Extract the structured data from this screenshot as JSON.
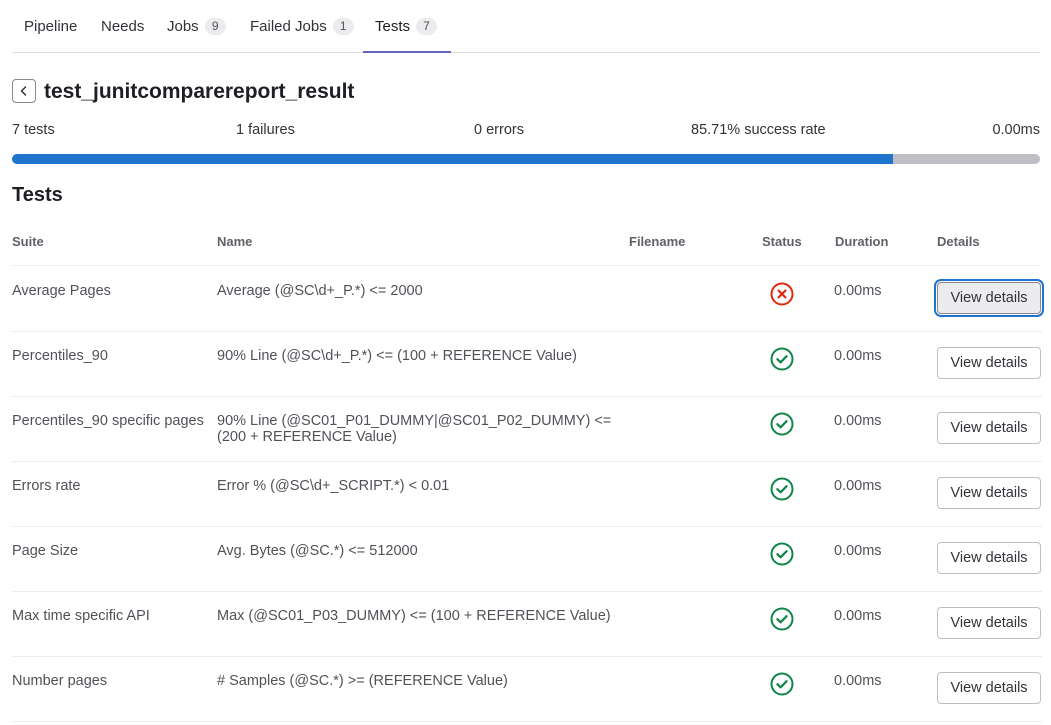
{
  "tabs": [
    {
      "label": "Pipeline"
    },
    {
      "label": "Needs"
    },
    {
      "label": "Jobs",
      "count": "9"
    },
    {
      "label": "Failed Jobs",
      "count": "1"
    },
    {
      "label": "Tests",
      "count": "7"
    }
  ],
  "header": {
    "title": "test_junitcomparereport_result",
    "back_icon": "chevron-left-icon"
  },
  "summary": {
    "tests": "7 tests",
    "failures": "1 failures",
    "errors": "0 errors",
    "success_rate": "85.71% success rate",
    "duration": "0.00ms",
    "success_fraction": 0.8571
  },
  "colors": {
    "progress_success": "#1f75cb",
    "progress_rest": "#bfbfc3",
    "status_failed": "#dd2b0e",
    "status_success": "#108548",
    "active_tab": "#6666c4"
  },
  "table": {
    "section_title": "Tests",
    "columns": {
      "suite": "Suite",
      "name": "Name",
      "filename": "Filename",
      "status": "Status",
      "duration": "Duration",
      "details": "Details"
    },
    "rows": [
      {
        "suite": "Average Pages",
        "name": "Average (@SC\\d+_P.*) <= 2000",
        "filename": "",
        "status": "failed",
        "status_icon": "status-failed-icon",
        "duration": "0.00ms",
        "action": "View details"
      },
      {
        "suite": "Percentiles_90",
        "name": "90% Line (@SC\\d+_P.*) <= (100 + REFERENCE Value)",
        "filename": "",
        "status": "success",
        "status_icon": "status-success-icon",
        "duration": "0.00ms",
        "action": "View details"
      },
      {
        "suite": "Percentiles_90 specific pages",
        "name": "90% Line (@SC01_P01_DUMMY|@SC01_P02_DUMMY) <= (200 + REFERENCE Value)",
        "filename": "",
        "status": "success",
        "status_icon": "status-success-icon",
        "duration": "0.00ms",
        "action": "View details"
      },
      {
        "suite": "Errors rate",
        "name": "Error % (@SC\\d+_SCRIPT.*) < 0.01",
        "filename": "",
        "status": "success",
        "status_icon": "status-success-icon",
        "duration": "0.00ms",
        "action": "View details"
      },
      {
        "suite": "Page Size",
        "name": "Avg. Bytes (@SC.*) <= 512000",
        "filename": "",
        "status": "success",
        "status_icon": "status-success-icon",
        "duration": "0.00ms",
        "action": "View details"
      },
      {
        "suite": "Max time specific API",
        "name": "Max (@SC01_P03_DUMMY) <= (100 + REFERENCE Value)",
        "filename": "",
        "status": "success",
        "status_icon": "status-success-icon",
        "duration": "0.00ms",
        "action": "View details"
      },
      {
        "suite": "Number pages",
        "name": "# Samples (@SC.*) >= (REFERENCE Value)",
        "filename": "",
        "status": "success",
        "status_icon": "status-success-icon",
        "duration": "0.00ms",
        "action": "View details"
      }
    ]
  }
}
